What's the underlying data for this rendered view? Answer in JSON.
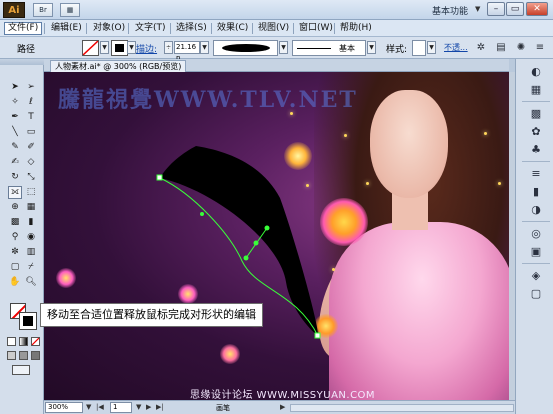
{
  "app": {
    "logo_text": "Ai",
    "title_icons": [
      "Br",
      "▦"
    ],
    "workspace_label": "基本功能",
    "window_buttons": [
      "–",
      "▭",
      "✕"
    ]
  },
  "menu": {
    "items": [
      "文件(F)",
      "编辑(E)",
      "对象(O)",
      "文字(T)",
      "选择(S)",
      "效果(C)",
      "视图(V)",
      "窗口(W)",
      "帮助(H)"
    ]
  },
  "control_bar": {
    "path_label": "路径",
    "stroke_label": "描边:",
    "stroke_weight": "21.16 p",
    "profile_label": "基本",
    "style_label": "样式:",
    "opacity_label": "不透..."
  },
  "document": {
    "tab_label": "人物素材.ai* @ 300% (RGB/预览)",
    "watermark": "騰龍視覺WWW.TLV.NET"
  },
  "caption": "移动至合适位置释放鼠标完成对形状的编辑",
  "status": {
    "zoom": "300%",
    "page": "1",
    "status_text": "画笔",
    "site_credit": "思缘设计论坛 WWW.MISSYUAN.COM"
  },
  "colors": {
    "accent_path": "#39ff39",
    "menu_active_border": "#5f7fa8",
    "canvas_dark": "#33103a"
  }
}
